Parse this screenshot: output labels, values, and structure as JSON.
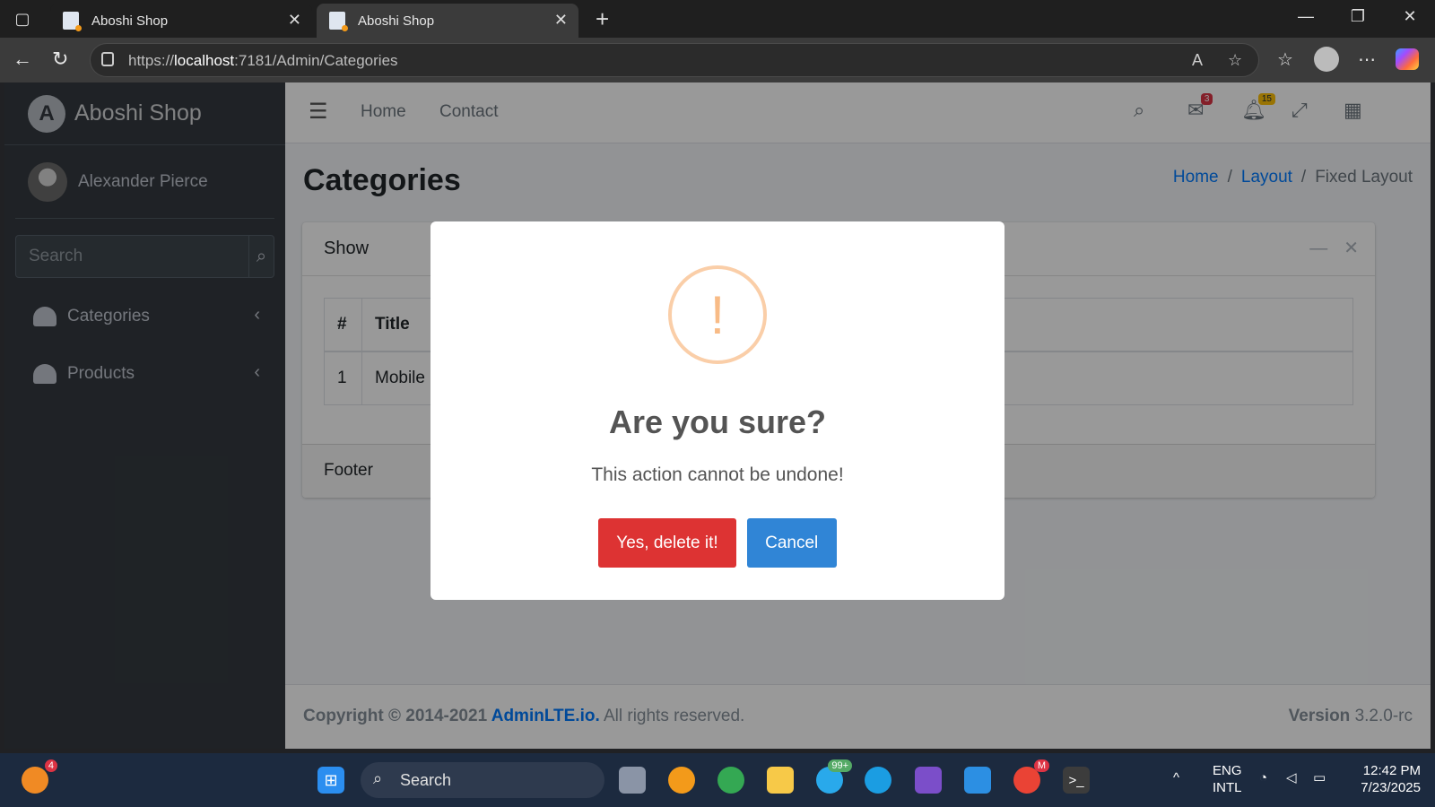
{
  "browser": {
    "tabs": [
      {
        "title": "Aboshi Shop",
        "active": false
      },
      {
        "title": "Aboshi Shop",
        "active": true
      }
    ],
    "url_prefix": "https://",
    "url_host": "localhost",
    "url_rest": ":7181/Admin/Categories"
  },
  "sidebar": {
    "brand": "Aboshi Shop",
    "brand_letter": "A",
    "user": "Alexander Pierce",
    "search_placeholder": "Search",
    "items": [
      {
        "label": "Categories"
      },
      {
        "label": "Products"
      }
    ]
  },
  "topnav": {
    "links": [
      "Home",
      "Contact"
    ],
    "messages_count": "3",
    "notifications_count": "15"
  },
  "page": {
    "title": "Categories",
    "breadcrumb": [
      "Home",
      "Layout",
      "Fixed Layout"
    ]
  },
  "card": {
    "title": "Show",
    "columns": [
      "#",
      "Title"
    ],
    "rows": [
      [
        "1",
        "Mobile"
      ]
    ],
    "footer": "Footer"
  },
  "footer": {
    "copyright": "Copyright © 2014-2021 ",
    "link": "AdminLTE.io.",
    "rights": " All rights reserved.",
    "version_label": "Version",
    "version": " 3.2.0-rc"
  },
  "modal": {
    "icon": "!",
    "title": "Are you sure?",
    "text": "This action cannot be undone!",
    "confirm": "Yes, delete it!",
    "cancel": "Cancel",
    "colors": {
      "confirm": "#dd3333",
      "cancel": "#3085d6",
      "icon": "#f8bb86"
    }
  },
  "taskbar": {
    "search": "Search",
    "notif_badge": "4",
    "telegram_badge": "99+",
    "chrome_badge": "M",
    "lang1": "ENG",
    "lang2": "INTL",
    "time": "12:42 PM",
    "date": "7/23/2025"
  }
}
